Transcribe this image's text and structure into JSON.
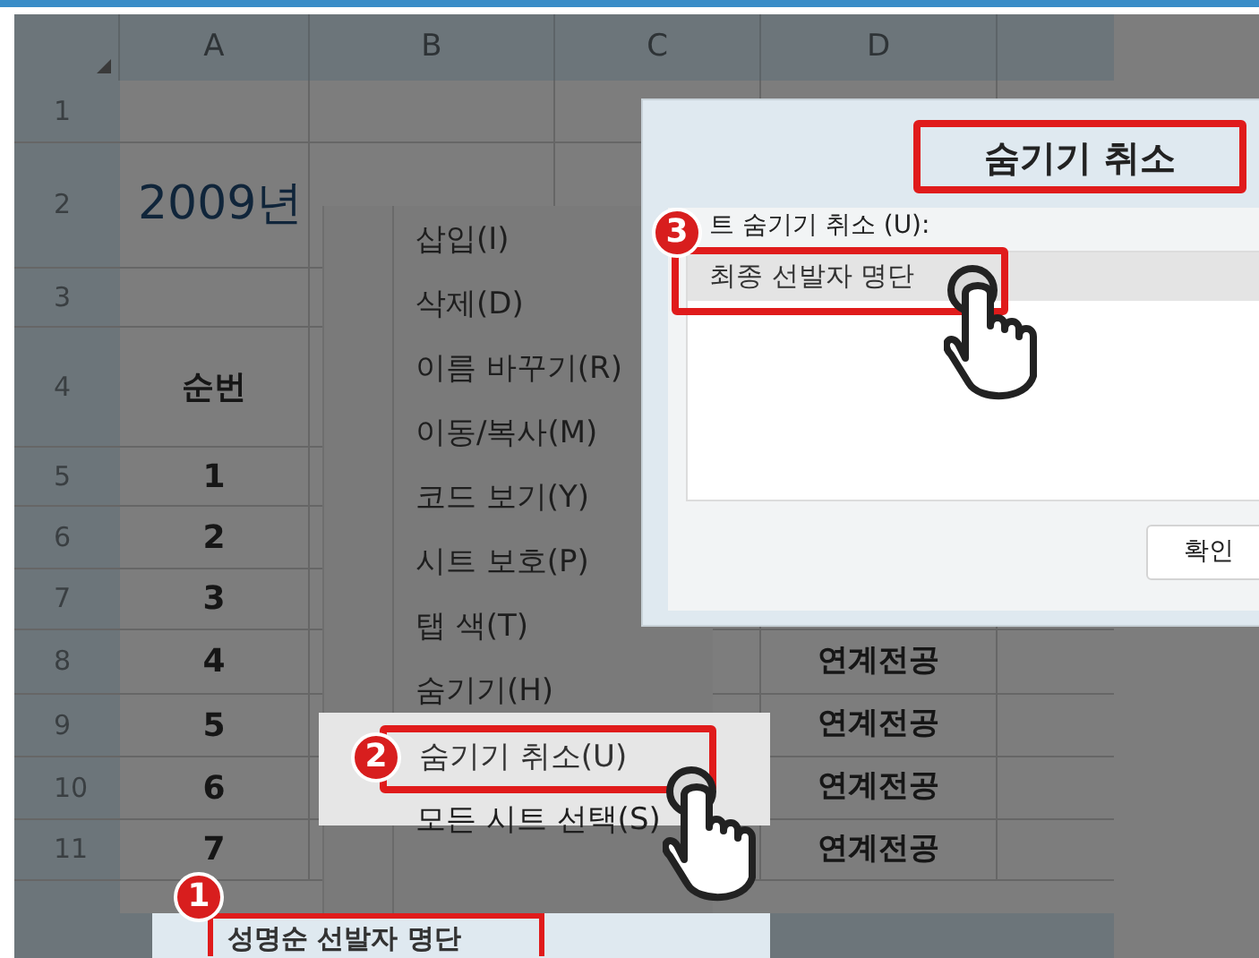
{
  "spreadsheet": {
    "columns": [
      "A",
      "B",
      "C",
      "D"
    ],
    "rows": [
      {
        "header": "1"
      },
      {
        "header": "2",
        "column_a": "2009년"
      },
      {
        "header": "3"
      },
      {
        "header": "4",
        "column_a": "순번"
      },
      {
        "header": "5",
        "column_a": "1"
      },
      {
        "header": "6",
        "column_a": "2"
      },
      {
        "header": "7",
        "column_a": "3"
      },
      {
        "header": "8",
        "column_a": "4",
        "column_d": "연계전공"
      },
      {
        "header": "9",
        "column_a": "5",
        "column_d": "연계전공"
      },
      {
        "header": "10",
        "column_a": "6",
        "column_d": "연계전공"
      },
      {
        "header": "11",
        "column_a": "7",
        "column_d": "연계전공"
      }
    ]
  },
  "context_menu": {
    "step": "2",
    "items": [
      {
        "label": "삽입(I)",
        "selected": false
      },
      {
        "label": "삭제(D)",
        "selected": false
      },
      {
        "label": "이름 바꾸기(R)",
        "selected": false
      },
      {
        "label": "이동/복사(M)",
        "selected": false
      },
      {
        "label": "코드 보기(Y)",
        "selected": false
      },
      {
        "label": "시트 보호(P)",
        "selected": false
      },
      {
        "label": "탭 색(T)",
        "selected": false
      },
      {
        "label": "숨기기(H)",
        "selected": false
      },
      {
        "label": "숨기기 취소(U)",
        "selected": true
      },
      {
        "label": "모든 시트 선택(S)",
        "selected": false
      }
    ]
  },
  "dialog": {
    "title": "숨기기 취소",
    "step": "3",
    "list_label": "트 숨기기 취소 (U):",
    "sheets": [
      {
        "label": "최종 선발자 명단",
        "selected": true
      }
    ],
    "buttons": [
      "확인"
    ]
  },
  "sheet_tab": {
    "step": "1",
    "label": "성명순 선발자 명단"
  }
}
